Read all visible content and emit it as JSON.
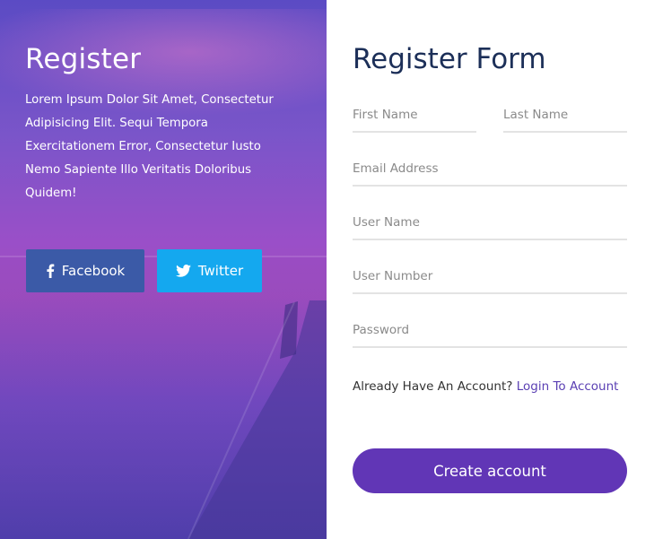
{
  "left": {
    "title": "Register",
    "description": "Lorem Ipsum Dolor Sit Amet, Consectetur Adipisicing Elit. Sequi Tempora Exercitationem Error, Consectetur Iusto Nemo Sapiente Illo Veritatis Doloribus Quidem!",
    "facebook_label": "Facebook",
    "twitter_label": "Twitter",
    "facebook_icon": "facebook-icon",
    "twitter_icon": "twitter-icon"
  },
  "form": {
    "title": "Register Form",
    "first_name_placeholder": "First Name",
    "last_name_placeholder": "Last Name",
    "email_placeholder": "Email Address",
    "username_placeholder": "User Name",
    "usernumber_placeholder": "User Number",
    "password_placeholder": "Password",
    "account_prompt": "Already Have An Account?",
    "login_link": "Login To Account",
    "submit_label": "Create account"
  },
  "colors": {
    "title": "#1c2f58",
    "facebook": "#3b5aa7",
    "twitter": "#14a8ef",
    "button": "#6136b6",
    "link": "#5a3fb3"
  }
}
